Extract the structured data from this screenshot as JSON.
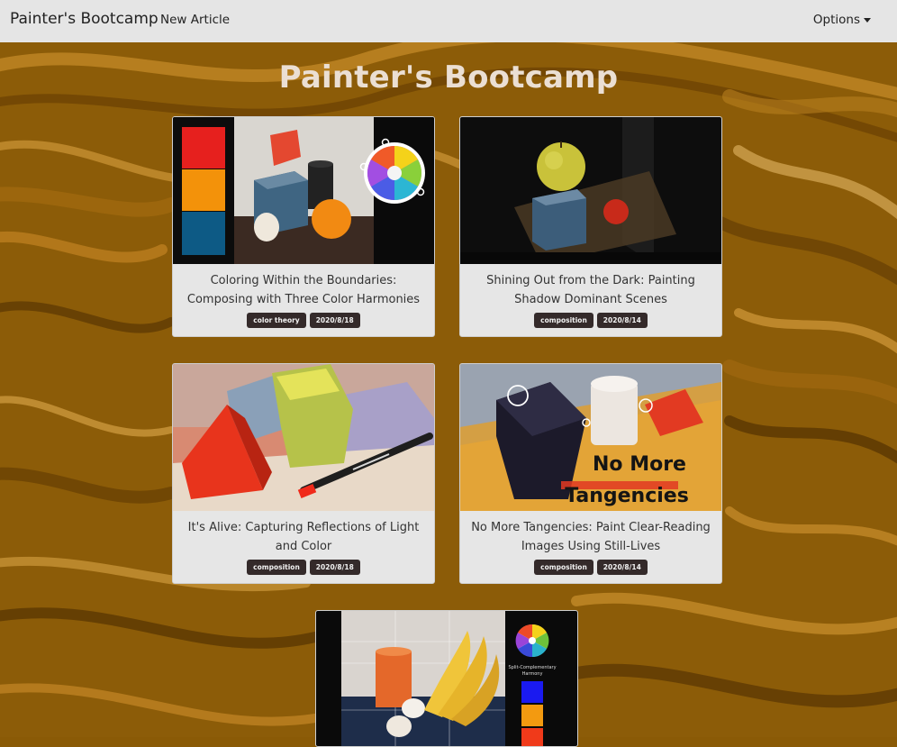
{
  "navbar": {
    "brand": "Painter's Bootcamp",
    "new_article": "New Article",
    "options": "Options"
  },
  "page": {
    "title": "Painter's Bootcamp"
  },
  "articles": [
    {
      "title": "Coloring Within the Boundaries: Composing with Three Color Harmonies",
      "tag": "color theory",
      "date": "2020/8/18"
    },
    {
      "title": "Shining Out from the Dark: Painting Shadow Dominant Scenes",
      "tag": "composition",
      "date": "2020/8/14"
    },
    {
      "title": "It's Alive: Capturing Reflections of Light and Color",
      "tag": "composition",
      "date": "2020/8/18"
    },
    {
      "title": "No More Tangencies: Paint Clear-Reading Images Using Still-Lives",
      "tag": "composition",
      "date": "2020/8/14",
      "image_text": [
        "No More",
        "Tangencies"
      ]
    },
    {
      "image_text": [
        "Split-Complementary",
        "Harmony"
      ]
    }
  ],
  "colors": {
    "navbar": "#e5e5e5",
    "background": "#8a5a06",
    "title": "#ebdfd3",
    "badge": "#342a2a",
    "card": "#e6e6e6"
  }
}
